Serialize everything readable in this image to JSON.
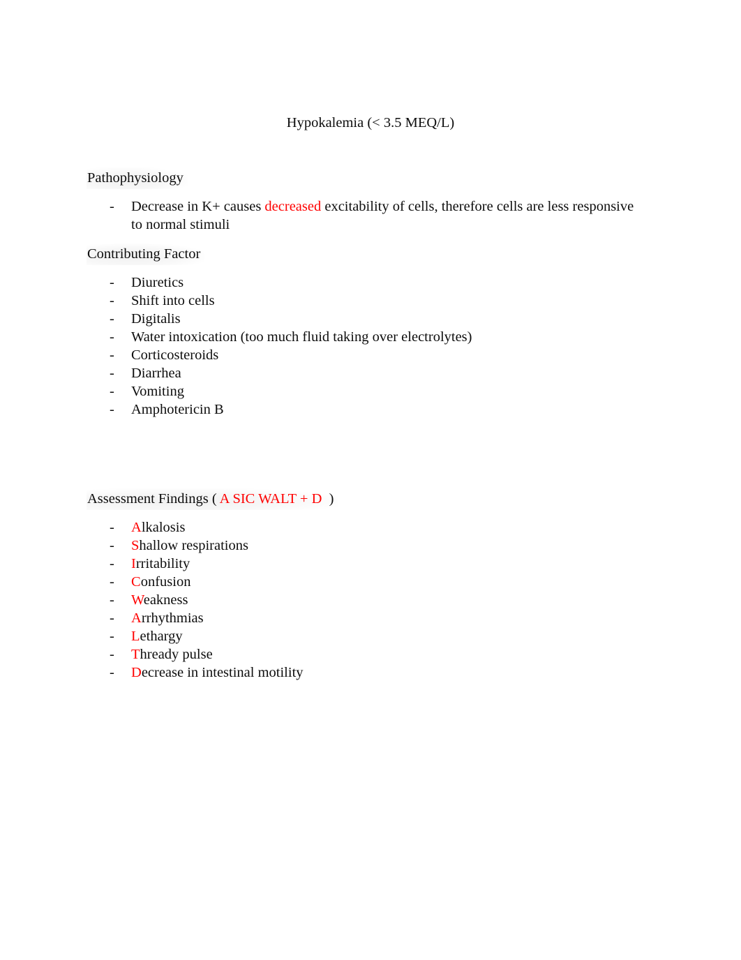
{
  "document": {
    "title": "Hypokalemia (< 3.5 MEQ/L)",
    "accent_color": "#ff0000",
    "text_color": "#0d0d0d",
    "background_color": "#ffffff"
  },
  "sections": {
    "pathophysiology": {
      "heading": "Pathophysiology",
      "bullets": [
        {
          "dash": "-",
          "pre": "Decrease in K+ causes ",
          "highlight": "decreased",
          "post": " excitability of cells, therefore cells are less responsive to normal stimuli"
        }
      ]
    },
    "contributing_factor": {
      "heading": "Contributing Factor",
      "bullets": [
        {
          "dash": "-",
          "text": "Diuretics"
        },
        {
          "dash": "-",
          "text": "Shift into cells"
        },
        {
          "dash": "-",
          "text": "Digitalis"
        },
        {
          "dash": "-",
          "text": "Water intoxication (too much fluid taking over electrolytes)"
        },
        {
          "dash": "-",
          "text": "Corticosteroids"
        },
        {
          "dash": "-",
          "text": "Diarrhea"
        },
        {
          "dash": "-",
          "text": "Vomiting"
        },
        {
          "dash": "-",
          "text": "Amphotericin B"
        }
      ]
    },
    "assessment_findings": {
      "heading_prefix": "Assessment Findings ( ",
      "mnemonic": "A SIC WALT + D",
      "heading_suffix": "  )",
      "bullets": [
        {
          "dash": "-",
          "initial": "A",
          "rest": "lkalosis"
        },
        {
          "dash": "-",
          "initial": "S",
          "rest": "hallow respirations"
        },
        {
          "dash": "-",
          "initial": "I",
          "rest": "rritability"
        },
        {
          "dash": "-",
          "initial": "C",
          "rest": "onfusion"
        },
        {
          "dash": "-",
          "initial": "W",
          "rest": "eakness"
        },
        {
          "dash": "-",
          "initial": "A",
          "rest": "rrhythmias"
        },
        {
          "dash": "-",
          "initial": "L",
          "rest": "ethargy"
        },
        {
          "dash": "-",
          "initial": "T",
          "rest": "hready pulse"
        },
        {
          "dash": "-",
          "initial": "D",
          "rest": "ecrease in intestinal motility"
        }
      ]
    }
  }
}
